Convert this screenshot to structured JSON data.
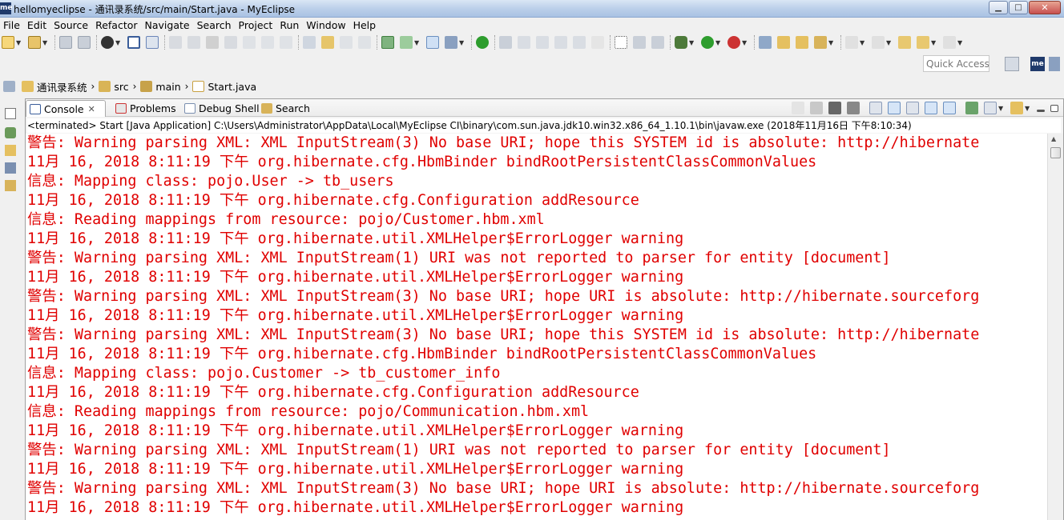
{
  "window": {
    "title": "hellomyeclipse - 通讯录系统/src/main/Start.java - MyEclipse",
    "app_icon_label": "me",
    "controls": {
      "minimize": "▁",
      "maximize": "□",
      "close": "✕"
    }
  },
  "menu": [
    "File",
    "Edit",
    "Source",
    "Refactor",
    "Navigate",
    "Search",
    "Project",
    "Run",
    "Window",
    "Help"
  ],
  "quick_access": {
    "placeholder": "Quick Access"
  },
  "perspective": {
    "label": "me"
  },
  "breadcrumb": [
    {
      "label": "通讯录系统",
      "icon": "project-icon"
    },
    {
      "label": "src",
      "icon": "source-folder-icon"
    },
    {
      "label": "main",
      "icon": "package-icon"
    },
    {
      "label": "Start.java",
      "icon": "java-file-icon"
    }
  ],
  "tabs": [
    {
      "label": "Console",
      "icon": "console-icon",
      "active": true,
      "close": "✕"
    },
    {
      "label": "Problems",
      "icon": "problems-icon",
      "active": false
    },
    {
      "label": "Debug Shell",
      "icon": "debug-shell-icon",
      "active": false
    },
    {
      "label": "Search",
      "icon": "search-icon",
      "active": false
    }
  ],
  "console": {
    "status": "<terminated> Start [Java Application] C:\\Users\\Administrator\\AppData\\Local\\MyEclipse CI\\binary\\com.sun.java.jdk10.win32.x86_64_1.10.1\\bin\\javaw.exe (2018年11月16日 下午8:10:34)",
    "text_color": "#e00000",
    "lines": [
      "警告: Warning parsing XML: XML InputStream(3) No base URI; hope this SYSTEM id is absolute: http://hibernate",
      "11月 16, 2018 8:11:19 下午 org.hibernate.cfg.HbmBinder bindRootPersistentClassCommonValues",
      "信息: Mapping class: pojo.User -> tb_users",
      "11月 16, 2018 8:11:19 下午 org.hibernate.cfg.Configuration addResource",
      "信息: Reading mappings from resource: pojo/Customer.hbm.xml",
      "11月 16, 2018 8:11:19 下午 org.hibernate.util.XMLHelper$ErrorLogger warning",
      "警告: Warning parsing XML: XML InputStream(1) URI was not reported to parser for entity [document]",
      "11月 16, 2018 8:11:19 下午 org.hibernate.util.XMLHelper$ErrorLogger warning",
      "警告: Warning parsing XML: XML InputStream(3) No base URI; hope URI is absolute: http://hibernate.sourceforg",
      "11月 16, 2018 8:11:19 下午 org.hibernate.util.XMLHelper$ErrorLogger warning",
      "警告: Warning parsing XML: XML InputStream(3) No base URI; hope this SYSTEM id is absolute: http://hibernate",
      "11月 16, 2018 8:11:19 下午 org.hibernate.cfg.HbmBinder bindRootPersistentClassCommonValues",
      "信息: Mapping class: pojo.Customer -> tb_customer_info",
      "11月 16, 2018 8:11:19 下午 org.hibernate.cfg.Configuration addResource",
      "信息: Reading mappings from resource: pojo/Communication.hbm.xml",
      "11月 16, 2018 8:11:19 下午 org.hibernate.util.XMLHelper$ErrorLogger warning",
      "警告: Warning parsing XML: XML InputStream(1) URI was not reported to parser for entity [document]",
      "11月 16, 2018 8:11:19 下午 org.hibernate.util.XMLHelper$ErrorLogger warning",
      "警告: Warning parsing XML: XML InputStream(3) No base URI; hope URI is absolute: http://hibernate.sourceforg",
      "11月 16, 2018 8:11:19 下午 org.hibernate.util.XMLHelper$ErrorLogger warning"
    ]
  }
}
